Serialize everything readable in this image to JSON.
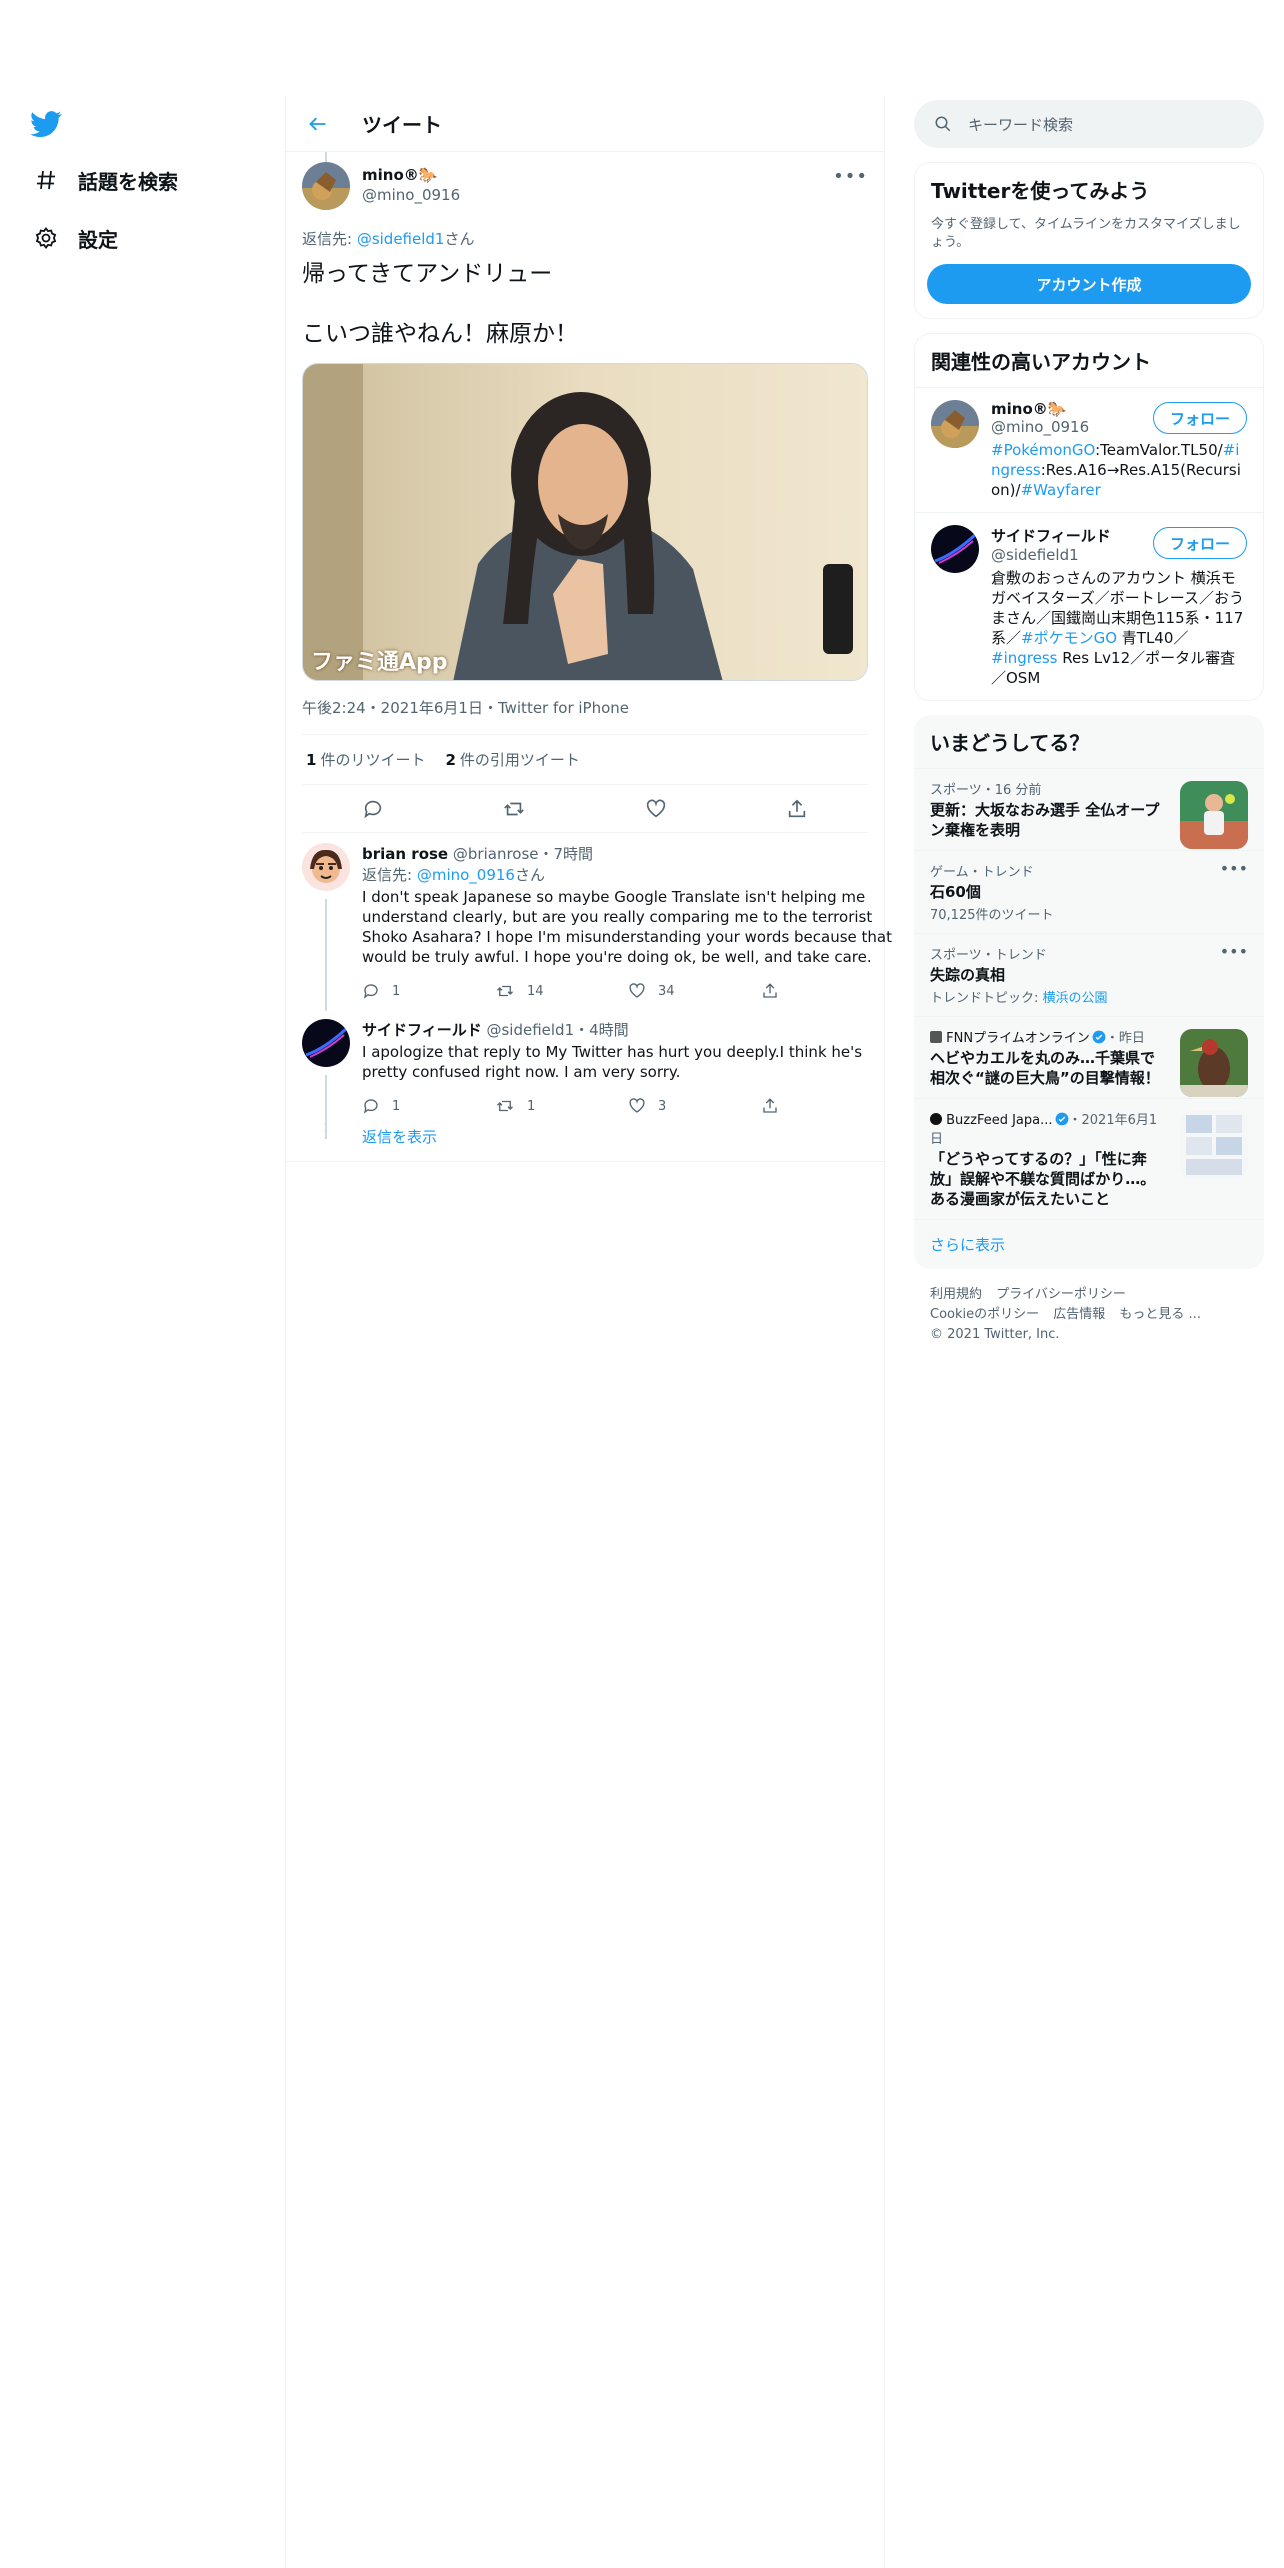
{
  "nav": {
    "items": [
      {
        "label": "話題を検索",
        "icon": "hashtag-icon"
      },
      {
        "label": "設定",
        "icon": "gear-icon"
      }
    ]
  },
  "main": {
    "header_title": "ツイート",
    "tweet": {
      "name": "mino®🐎",
      "handle": "@mino_0916",
      "reply_to_prefix": "返信先: ",
      "reply_to_handle": "@sidefield1",
      "reply_to_suffix": "さん",
      "text": "帰ってきてアンドリュー\n\nこいつ誰やねん！麻原か！",
      "media_watermark": "ファミ通App",
      "meta": "午後2:24・2021年6月1日・Twitter for iPhone",
      "retweets_count": "1",
      "retweets_label": "件のリツイート",
      "quotes_count": "2",
      "quotes_label": "件の引用ツイート"
    },
    "replies": [
      {
        "name": "brian rose",
        "handle": "@brianrose",
        "time": "・7時間",
        "reply_to_prefix": "返信先: ",
        "reply_to_handle": "@mino_0916",
        "reply_to_suffix": "さん",
        "text": "I don't speak Japanese so maybe Google Translate isn't helping me understand clearly, but are you really comparing me to the terrorist Shoko Asahara? I hope I'm misunderstanding your words because that would be truly awful. I hope you're doing ok, be well, and take care.",
        "reply_count": "1",
        "retweet_count": "14",
        "like_count": "34"
      },
      {
        "name": "サイドフィールド",
        "handle": "@sidefield1",
        "time": "・4時間",
        "text": "I apologize that reply to My Twitter has hurt you deeply.I think he's pretty confused right now. I am very sorry.",
        "reply_count": "1",
        "retweet_count": "1",
        "like_count": "3"
      }
    ],
    "show_replies": "返信を表示"
  },
  "right": {
    "search_placeholder": "キーワード検索",
    "signup": {
      "title": "Twitterを使ってみよう",
      "desc": "今すぐ登録して、タイムラインをカスタマイズしましょう。",
      "button": "アカウント作成"
    },
    "relevant": {
      "title": "関連性の高いアカウント",
      "follow_label": "フォロー",
      "accounts": [
        {
          "name": "mino®🐎",
          "handle": "@mino_0916",
          "bio_parts": [
            "#PokémonGO",
            ":TeamValor.TL50/",
            "#ingress",
            ":Res.A16→Res.A15(Recursion)/",
            "#Wayfarer"
          ]
        },
        {
          "name": "サイドフィールド",
          "handle": "@sidefield1",
          "bio_parts": [
            "倉敷のおっさんのアカウント 横浜モガベイスターズ／ボートレース／おうまさん／国鐵崗山末期色115系・117系／",
            "#ポケモンGO",
            " 青TL40／",
            "#ingress",
            " Res Lv12／ポータル審査／OSM"
          ]
        }
      ]
    },
    "trends": {
      "title": "いまどうしてる？",
      "items": [
        {
          "category": "スポーツ・16 分前",
          "title": "更新：大坂なおみ選手 全仏オープン棄権を表明"
        },
        {
          "category": "ゲーム・トレンド",
          "title": "石60個",
          "sub": "70,125件のツイート"
        },
        {
          "category": "スポーツ・トレンド",
          "title": "失踪の真相",
          "sub_prefix": "トレンドトピック: ",
          "sub_link": "横浜の公園"
        },
        {
          "category_source": "FNNプライムオンライン",
          "category_time": "・昨日",
          "title": "ヘビやカエルを丸のみ…千葉県で相次ぐ“謎の巨大鳥”の目撃情報！"
        },
        {
          "category_source": "BuzzFeed Japa...",
          "category_time": "・2021年6月1日",
          "title": "「どうやってするの？」「性に奔放」誤解や不躾な質問ばかり…。ある漫画家が伝えたいこと"
        }
      ],
      "show_more": "さらに表示"
    },
    "footer": {
      "links1": [
        "利用規約",
        "プライバシーポリシー"
      ],
      "links2": [
        "Cookieのポリシー",
        "広告情報",
        "もっと見る ..."
      ],
      "copyright": "© 2021 Twitter, Inc."
    }
  }
}
